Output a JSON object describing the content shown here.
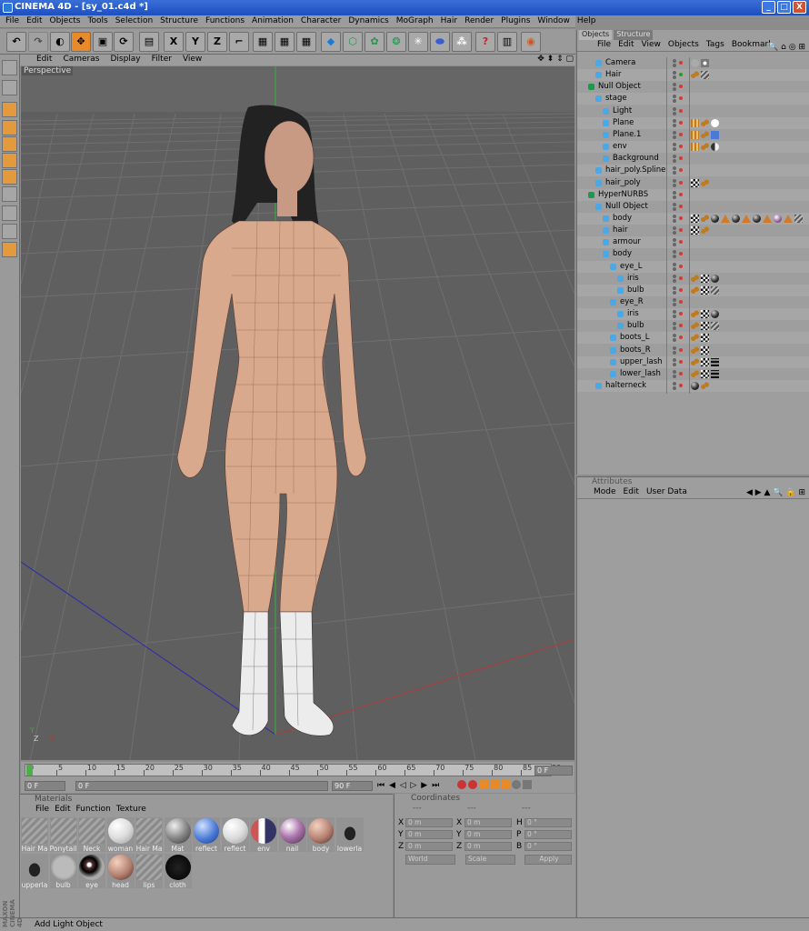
{
  "window": {
    "title": "CINEMA 4D - [sy_01.c4d *]",
    "minimize": "_",
    "maximize": "□",
    "close": "X"
  },
  "menubar": [
    "File",
    "Edit",
    "Objects",
    "Tools",
    "Selection",
    "Structure",
    "Functions",
    "Animation",
    "Character",
    "Dynamics",
    "MoGraph",
    "Hair",
    "Render",
    "Plugins",
    "Window",
    "Help"
  ],
  "toolbar": {
    "axis_x": "X",
    "axis_y": "Y",
    "axis_z": "Z"
  },
  "viewport": {
    "menu": [
      "Edit",
      "Cameras",
      "Display",
      "Filter",
      "View"
    ],
    "label": "Perspective",
    "axis_labels": {
      "x": "X",
      "y": "Y",
      "z": "Z"
    }
  },
  "timeline": {
    "ticks": [
      "0",
      "5",
      "10",
      "15",
      "20",
      "25",
      "30",
      "35",
      "40",
      "45",
      "50",
      "55",
      "60",
      "65",
      "70",
      "75",
      "80",
      "85",
      "90"
    ],
    "current_frame": "0 F",
    "start_field": "0 F",
    "min_field": "0 F",
    "max_field": "90 F",
    "end_field": "90 F"
  },
  "materials": {
    "title": "Materials",
    "menu": [
      "File",
      "Edit",
      "Function",
      "Texture"
    ],
    "items": [
      {
        "label": "Hair Ma",
        "kind": "hatch"
      },
      {
        "label": "Ponytail",
        "kind": "hatch"
      },
      {
        "label": "Neck",
        "kind": "hatch"
      },
      {
        "label": "woman",
        "kind": "white"
      },
      {
        "label": "Hair Ma",
        "kind": "hatch"
      },
      {
        "label": "Mat",
        "kind": "grey"
      },
      {
        "label": "reflect",
        "kind": "blue"
      },
      {
        "label": "reflect",
        "kind": "white"
      },
      {
        "label": "env",
        "kind": "env"
      },
      {
        "label": "nail",
        "kind": "purple"
      },
      {
        "label": "body",
        "kind": "skin"
      },
      {
        "label": "lowerla",
        "kind": "lash"
      },
      {
        "label": "upperla",
        "kind": "lash"
      },
      {
        "label": "bulb",
        "kind": "bulb"
      },
      {
        "label": "eye",
        "kind": "eye"
      },
      {
        "label": "head",
        "kind": "skin"
      },
      {
        "label": "lips",
        "kind": "hatch"
      },
      {
        "label": "cloth",
        "kind": "cloth"
      }
    ]
  },
  "coordinates": {
    "title": "Coordinates",
    "col_headers": [
      "---",
      "---",
      "---"
    ],
    "rows": [
      {
        "l1": "X",
        "v1": "0 m",
        "l2": "X",
        "v2": "0 m",
        "l3": "H",
        "v3": "0 °"
      },
      {
        "l1": "Y",
        "v1": "0 m",
        "l2": "Y",
        "v2": "0 m",
        "l3": "P",
        "v3": "0 °"
      },
      {
        "l1": "Z",
        "v1": "0 m",
        "l2": "Z",
        "v2": "0 m",
        "l3": "B",
        "v3": "0 °"
      }
    ],
    "mode_select": "World",
    "scale_select": "Scale",
    "apply": "Apply"
  },
  "objects": {
    "tabs": [
      "Objects",
      "Structure"
    ],
    "menu": [
      "File",
      "Edit",
      "View",
      "Objects",
      "Tags",
      "Bookmarl"
    ],
    "tree": [
      {
        "name": "Camera",
        "indent": 1,
        "tags": [
          "camtag",
          "dots"
        ]
      },
      {
        "name": "Hair",
        "indent": 1,
        "tags": [
          "hairtag",
          "hatch"
        ]
      },
      {
        "name": "Null Object",
        "indent": 0,
        "tags": []
      },
      {
        "name": "stage",
        "indent": 1,
        "tags": []
      },
      {
        "name": "Light",
        "indent": 2,
        "tags": []
      },
      {
        "name": "Plane",
        "indent": 2,
        "tags": [
          "film",
          "hairtag",
          "white"
        ]
      },
      {
        "name": "Plane.1",
        "indent": 2,
        "tags": [
          "film",
          "hairtag",
          "blue"
        ]
      },
      {
        "name": "env",
        "indent": 2,
        "tags": [
          "film",
          "hairtag",
          "half"
        ]
      },
      {
        "name": "Background",
        "indent": 2,
        "tags": []
      },
      {
        "name": "hair_poly.Spline",
        "indent": 1,
        "tags": []
      },
      {
        "name": "hair_poly",
        "indent": 1,
        "tags": [
          "check",
          "hairtag"
        ]
      },
      {
        "name": "HyperNURBS",
        "indent": 0,
        "tags": []
      },
      {
        "name": "Null Object",
        "indent": 1,
        "tags": []
      },
      {
        "name": "body",
        "indent": 2,
        "tags": [
          "check",
          "hairtag",
          "darkball",
          "tri",
          "darkball",
          "tri",
          "darkball",
          "tri",
          "purple",
          "tri",
          "hatch"
        ]
      },
      {
        "name": "hair",
        "indent": 2,
        "tags": [
          "check",
          "hairtag"
        ]
      },
      {
        "name": "armour",
        "indent": 2,
        "tags": []
      },
      {
        "name": "body",
        "indent": 2,
        "tags": []
      },
      {
        "name": "eye_L",
        "indent": 3,
        "tags": []
      },
      {
        "name": "iris",
        "indent": 4,
        "tags": [
          "hairtag",
          "check",
          "darkball"
        ]
      },
      {
        "name": "bulb",
        "indent": 4,
        "tags": [
          "hairtag",
          "check",
          "hatch"
        ]
      },
      {
        "name": "eye_R",
        "indent": 3,
        "tags": []
      },
      {
        "name": "iris",
        "indent": 4,
        "tags": [
          "hairtag",
          "check",
          "darkball"
        ]
      },
      {
        "name": "bulb",
        "indent": 4,
        "tags": [
          "hairtag",
          "check",
          "hatch"
        ]
      },
      {
        "name": "boots_L",
        "indent": 3,
        "tags": [
          "hairtag",
          "check"
        ]
      },
      {
        "name": "boots_R",
        "indent": 3,
        "tags": [
          "hairtag",
          "check"
        ]
      },
      {
        "name": "upper_lash",
        "indent": 3,
        "tags": [
          "hairtag",
          "check",
          "lash"
        ]
      },
      {
        "name": "lower_lash",
        "indent": 3,
        "tags": [
          "hairtag",
          "check",
          "lash"
        ]
      },
      {
        "name": "halterneck",
        "indent": 1,
        "tags": [
          "darkball",
          "hairtag"
        ]
      }
    ]
  },
  "attributes": {
    "title": "Attributes",
    "menu": [
      "Mode",
      "Edit",
      "User Data"
    ]
  },
  "status": "Add Light Object",
  "brand": "MAXON CINEMA 4D",
  "colors": {
    "accent": "#e88a2a",
    "title_blue": "#1d4fbf",
    "viewport_bg": "#5f5f5f",
    "skin": "#d9a98d",
    "grid": "#6e6e6e"
  }
}
